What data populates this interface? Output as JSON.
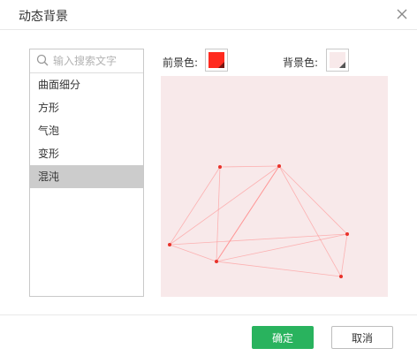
{
  "dialog": {
    "title": "动态背景"
  },
  "search": {
    "placeholder": "输入搜索文字",
    "value": ""
  },
  "effects": {
    "items": [
      {
        "label": "曲面细分",
        "selected": false
      },
      {
        "label": "方形",
        "selected": false
      },
      {
        "label": "气泡",
        "selected": false
      },
      {
        "label": "变形",
        "selected": false
      },
      {
        "label": "混沌",
        "selected": true
      }
    ]
  },
  "colors": {
    "foreground_label": "前景色:",
    "foreground_value": "#ff2a1f",
    "background_label": "背景色:",
    "background_value": "#f8e9ea"
  },
  "preview": {
    "line_color": "#ff8c8c",
    "point_color": "#e8322a",
    "fill": "#f8e9ea"
  },
  "footer": {
    "ok_label": "确定",
    "cancel_label": "取消",
    "accent": "#29b35e"
  },
  "icons": {
    "close": "close-icon",
    "search": "search-icon"
  }
}
